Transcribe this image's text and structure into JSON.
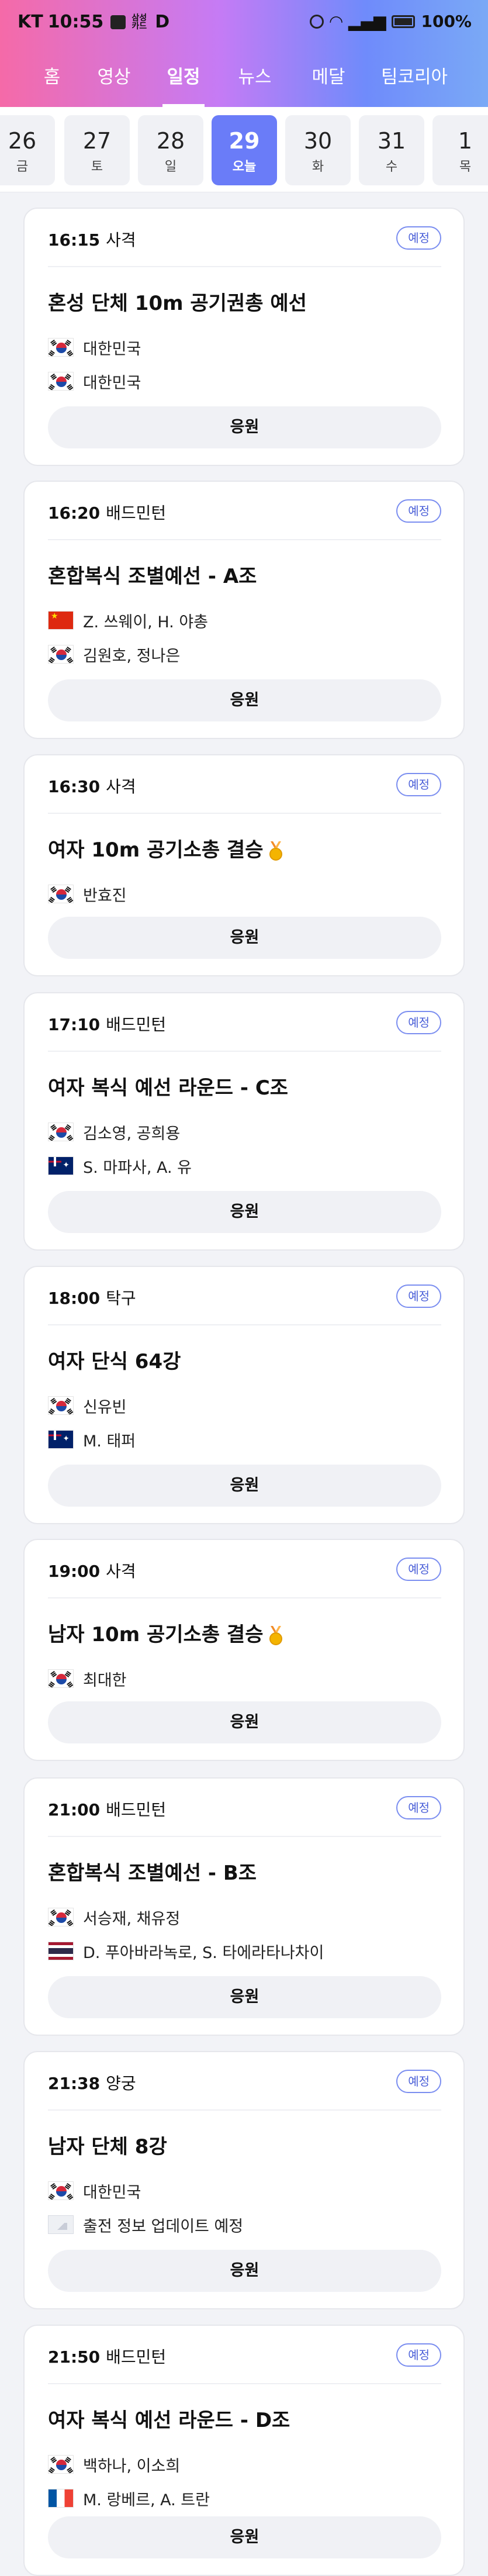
{
  "status_bar": {
    "carrier": "KT",
    "time": "10:55",
    "small_icon_text": "삼성\n카드",
    "app_letter": "D",
    "battery": "100%"
  },
  "nav": {
    "tabs": [
      {
        "label": "홈"
      },
      {
        "label": "영상"
      },
      {
        "label": "일정",
        "active": true
      },
      {
        "label": "뉴스"
      },
      {
        "label": "메달"
      },
      {
        "label": "팀코리아"
      }
    ]
  },
  "dates": [
    {
      "num": "26",
      "dow": "금"
    },
    {
      "num": "27",
      "dow": "토"
    },
    {
      "num": "28",
      "dow": "일"
    },
    {
      "num": "29",
      "dow": "오늘",
      "active": true
    },
    {
      "num": "30",
      "dow": "화"
    },
    {
      "num": "31",
      "dow": "수"
    },
    {
      "num": "1",
      "dow": "목"
    }
  ],
  "colors": {
    "accent": "#6a7cf8",
    "badge_border": "#7b8ef0",
    "card_bg": "#ffffff",
    "page_bg": "#f2f3f7"
  },
  "events": [
    {
      "time": "16:15",
      "sport": "사격",
      "badge": "예정",
      "title": "혼성 단체 10m 공기권총 예선",
      "medal": false,
      "participants": [
        {
          "flag": "kr",
          "name": "대한민국"
        },
        {
          "flag": "kr",
          "name": "대한민국"
        }
      ],
      "cheer": "응원"
    },
    {
      "time": "16:20",
      "sport": "배드민턴",
      "badge": "예정",
      "title": "혼합복식 조별예선 - A조",
      "medal": false,
      "participants": [
        {
          "flag": "cn",
          "name": "Z. 쓰웨이, H. 야총"
        },
        {
          "flag": "kr",
          "name": "김원호, 정나은"
        }
      ],
      "cheer": "응원"
    },
    {
      "time": "16:30",
      "sport": "사격",
      "badge": "예정",
      "title": "여자 10m 공기소총 결승",
      "medal": true,
      "participants": [
        {
          "flag": "kr",
          "name": "반효진"
        }
      ],
      "cheer": "응원"
    },
    {
      "time": "17:10",
      "sport": "배드민턴",
      "badge": "예정",
      "title": "여자 복식 예선 라운드 - C조",
      "medal": false,
      "participants": [
        {
          "flag": "kr",
          "name": "김소영, 공희용"
        },
        {
          "flag": "au",
          "name": "S. 마파사, A. 유"
        }
      ],
      "cheer": "응원"
    },
    {
      "time": "18:00",
      "sport": "탁구",
      "badge": "예정",
      "title": "여자 단식 64강",
      "medal": false,
      "participants": [
        {
          "flag": "kr",
          "name": "신유빈"
        },
        {
          "flag": "au",
          "name": "M. 태퍼"
        }
      ],
      "cheer": "응원"
    },
    {
      "time": "19:00",
      "sport": "사격",
      "badge": "예정",
      "title": "남자 10m 공기소총 결승",
      "medal": true,
      "participants": [
        {
          "flag": "kr",
          "name": "최대한"
        }
      ],
      "cheer": "응원"
    },
    {
      "time": "21:00",
      "sport": "배드민턴",
      "badge": "예정",
      "title": "혼합복식 조별예선 - B조",
      "medal": false,
      "participants": [
        {
          "flag": "kr",
          "name": "서승재, 채유정"
        },
        {
          "flag": "th",
          "name": "D. 푸아바라녹로, S. 타에라타나차이"
        }
      ],
      "cheer": "응원"
    },
    {
      "time": "21:38",
      "sport": "양궁",
      "badge": "예정",
      "title": "남자 단체 8강",
      "medal": false,
      "participants": [
        {
          "flag": "kr",
          "name": "대한민국"
        },
        {
          "flag": "none",
          "name": "출전 정보 업데이트 예정"
        }
      ],
      "cheer": "응원"
    },
    {
      "time": "21:50",
      "sport": "배드민턴",
      "badge": "예정",
      "title": "여자 복식 예선 라운드 - D조",
      "medal": false,
      "participants": [
        {
          "flag": "kr",
          "name": "백하나, 이소희"
        },
        {
          "flag": "fr",
          "name": "M. 랑베르, A. 트란"
        }
      ],
      "cheer": "응원"
    }
  ]
}
